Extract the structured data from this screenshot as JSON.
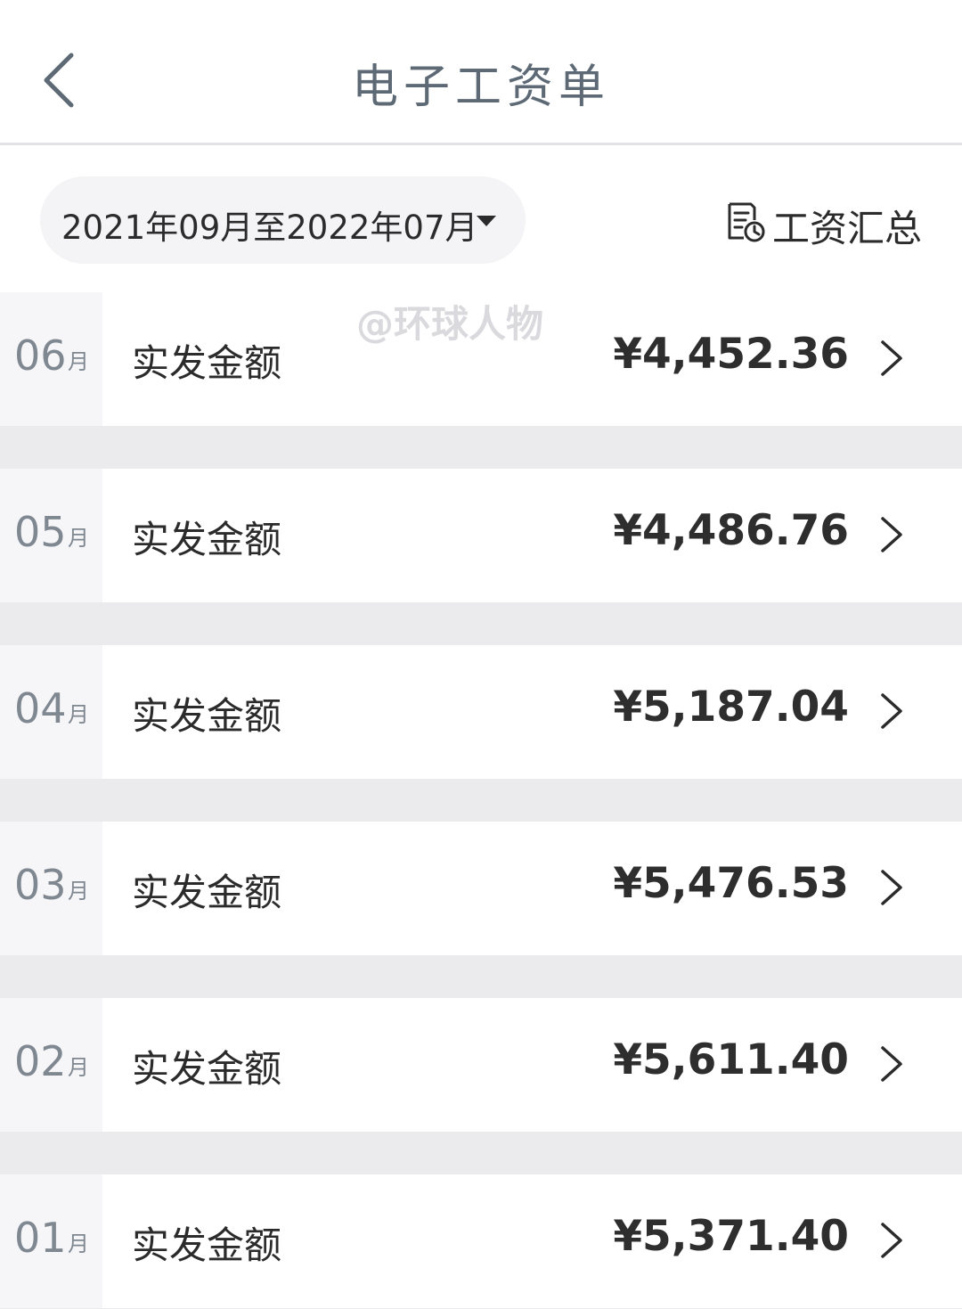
{
  "header": {
    "title": "电子工资单"
  },
  "toolbar": {
    "period_label": "2021年09月至2022年07月",
    "summary_label": "工资汇总"
  },
  "watermark": "@环球人物",
  "payslips": [
    {
      "month": "06",
      "unit": "月",
      "label": "实发金额",
      "amount": "¥4,452.36"
    },
    {
      "month": "05",
      "unit": "月",
      "label": "实发金额",
      "amount": "¥4,486.76"
    },
    {
      "month": "04",
      "unit": "月",
      "label": "实发金额",
      "amount": "¥5,187.04"
    },
    {
      "month": "03",
      "unit": "月",
      "label": "实发金额",
      "amount": "¥5,476.53"
    },
    {
      "month": "02",
      "unit": "月",
      "label": "实发金额",
      "amount": "¥5,611.40"
    },
    {
      "month": "01",
      "unit": "月",
      "label": "实发金额",
      "amount": "¥5,371.40"
    }
  ],
  "icons": {
    "back": "chevron-left-icon",
    "dropdown": "caret-down-icon",
    "summary": "document-clock-icon",
    "row_arrow": "chevron-right-icon"
  },
  "colors": {
    "title": "#5d6a75",
    "month": "#7f8790",
    "text": "#2b2b2b",
    "background": "#ebebee"
  }
}
